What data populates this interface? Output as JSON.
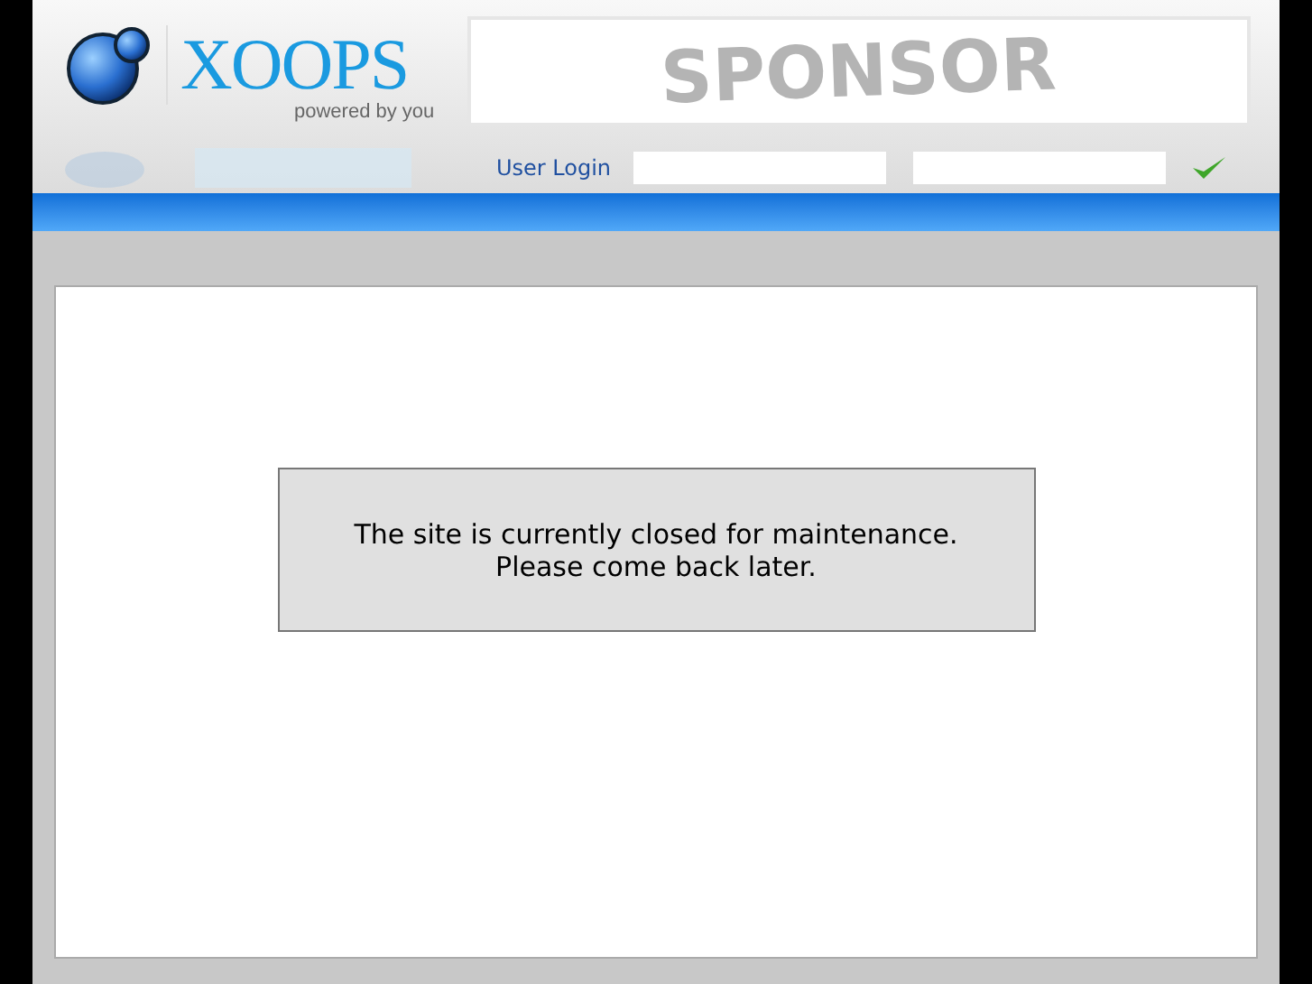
{
  "header": {
    "logo_text": "XOOPS",
    "tagline": "powered by you",
    "banner_text": "SPONSOR"
  },
  "login": {
    "label": "User Login"
  },
  "message": [
    "The site is currently closed for maintenance.",
    "Please come back later."
  ]
}
